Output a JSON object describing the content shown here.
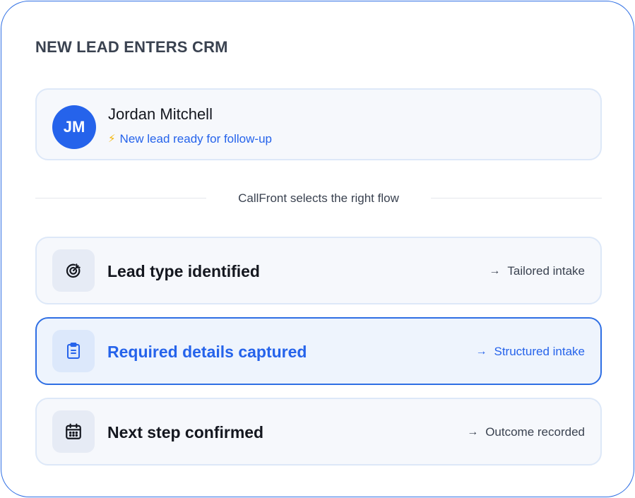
{
  "heading": "NEW LEAD ENTERS CRM",
  "lead": {
    "initials": "JM",
    "name": "Jordan Mitchell",
    "status_icon": "lightning-icon",
    "status": "New lead ready for follow-up"
  },
  "divider_text": "CallFront selects the right flow",
  "steps": [
    {
      "icon": "target-icon",
      "title": "Lead type identified",
      "outcome": "Tailored intake",
      "active": false
    },
    {
      "icon": "clipboard-icon",
      "title": "Required details captured",
      "outcome": "Structured intake",
      "active": true
    },
    {
      "icon": "calendar-icon",
      "title": "Next step confirmed",
      "outcome": "Outcome recorded",
      "active": false
    }
  ],
  "colors": {
    "accent": "#2563eb",
    "frame_border": "#2f6fe4",
    "card_bg": "#f6f8fc",
    "active_bg": "#eef4fd",
    "bolt": "#f5b400"
  }
}
